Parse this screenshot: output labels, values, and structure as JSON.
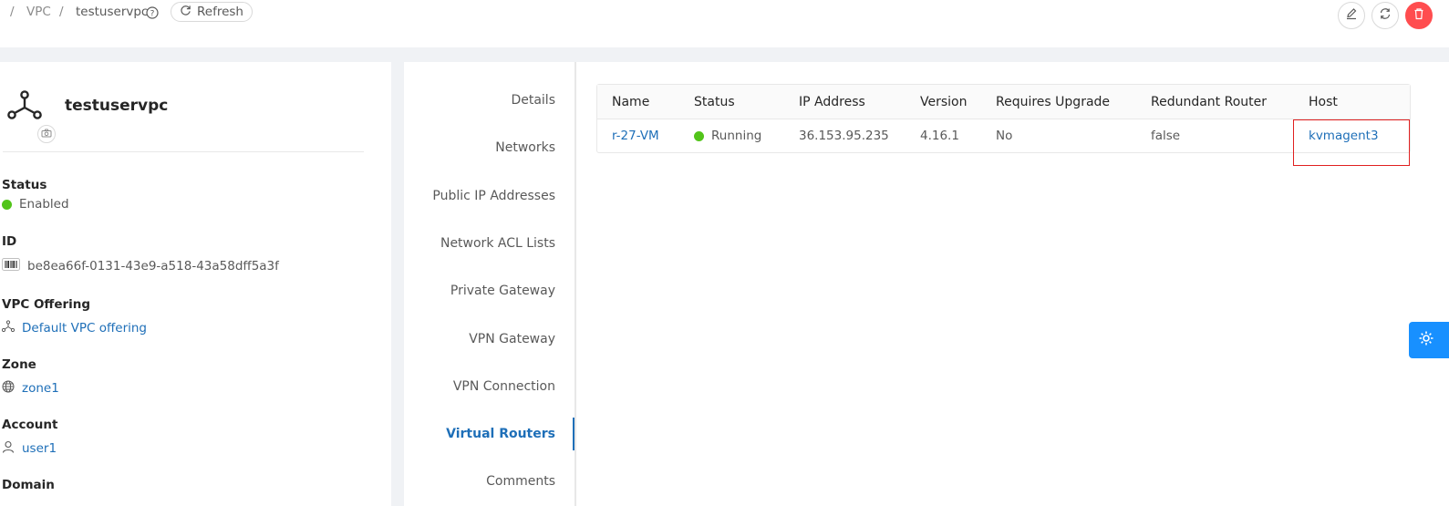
{
  "breadcrumb": {
    "sep": "/",
    "vpc": "VPC",
    "current": "testuservpc"
  },
  "toolbar": {
    "refresh_label": "Refresh"
  },
  "vpc": {
    "name": "testuservpc"
  },
  "details": {
    "status": {
      "label": "Status",
      "value": "Enabled"
    },
    "id": {
      "label": "ID",
      "value": "be8ea66f-0131-43e9-a518-43a58dff5a3f"
    },
    "offering": {
      "label": "VPC Offering",
      "value": "Default VPC offering"
    },
    "zone": {
      "label": "Zone",
      "value": "zone1"
    },
    "account": {
      "label": "Account",
      "value": "user1"
    },
    "domain": {
      "label": "Domain"
    }
  },
  "tabs": [
    "Details",
    "Networks",
    "Public IP Addresses",
    "Network ACL Lists",
    "Private Gateway",
    "VPN Gateway",
    "VPN Connection",
    "Virtual Routers",
    "Comments"
  ],
  "active_tab": "Virtual Routers",
  "table": {
    "columns": [
      "Name",
      "Status",
      "IP Address",
      "Version",
      "Requires Upgrade",
      "Redundant Router",
      "Host"
    ],
    "rows": [
      {
        "name": "r-27-VM",
        "status": "Running",
        "ip": "36.153.95.235",
        "version": "4.16.1",
        "requires_upgrade": "No",
        "redundant_router": "false",
        "host": "kvmagent3"
      }
    ]
  },
  "colors": {
    "accent": "#1e6fb8",
    "success": "#52c41a",
    "danger": "#ff4d4f",
    "fab": "#1890ff",
    "highlight": "#e02020"
  }
}
